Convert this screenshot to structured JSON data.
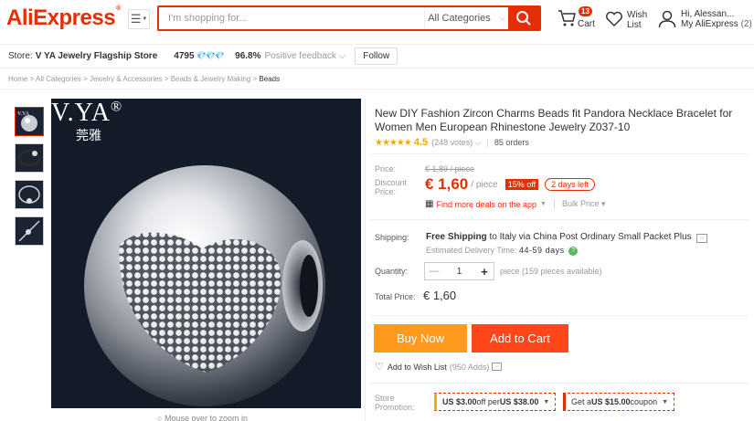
{
  "header": {
    "logo": "AliExpress",
    "logo_mark": "®",
    "search_placeholder": "I'm shopping for...",
    "search_category": "All Categories",
    "cart_count": "13",
    "cart_label": "Cart",
    "wish_label_1": "Wish",
    "wish_label_2": "List",
    "account_greeting": "Hi, Alessan...",
    "account_link": "My AliExpress",
    "account_count": "(2)"
  },
  "store": {
    "label": "Store:",
    "name": "V YA Jewelry Flagship Store",
    "score": "4795",
    "gems": "💎💎💎",
    "feedback_pct": "96.8%",
    "feedback_label": "Positive feedback",
    "follow_label": "Follow"
  },
  "breadcrumb": [
    "Home",
    "All Categories",
    "Jewelry & Accessories",
    "Beads & Jewelry Making",
    "Beads"
  ],
  "gallery": {
    "brand": "V.YA",
    "brand_mark": "®",
    "brand_cn": "莞雅",
    "zoom_hint": "Mouse over to zoom in"
  },
  "product": {
    "title": "New DIY Fashion Zircon Charms Beads fit Pandora Necklace Bracelet for Women Men European Rhinestone Jewelry Z037-10",
    "stars": "★★★★★",
    "rating": "4.5",
    "votes": "(248 votes)",
    "orders": "85 orders",
    "price_label": "Price:",
    "old_price": "€ 1,89 / piece",
    "discount_label_1": "Discount",
    "discount_label_2": "Price:",
    "price": "€ 1,60",
    "price_unit": "/ piece",
    "discount_badge": "15% off",
    "days_left": "2 days left",
    "app_deals": "Find more deals on the app",
    "bulk_price": "Bulk Price",
    "shipping_label": "Shipping:",
    "shipping_bold": "Free Shipping",
    "shipping_rest": " to Italy via China Post Ordinary Small Packet Plus",
    "delivery_label": "Estimated Delivery Time:",
    "delivery_days": "44-59 days",
    "quantity_label": "Quantity:",
    "quantity": "1",
    "quantity_note": "piece (159 pieces available)",
    "total_label": "Total Price:",
    "total": "€ 1,60",
    "buy_now": "Buy Now",
    "add_to_cart": "Add to Cart",
    "wish_label": "Add to Wish List",
    "wish_count": "(950 Adds)",
    "promo_label_1": "Store",
    "promo_label_2": "Promotion:",
    "promo1_pre": "US $3.00",
    "promo1_mid": " off per ",
    "promo1_post": "US $38.00",
    "promo2_pre": "Get a ",
    "promo2_bold": "US $15.00",
    "promo2_post": " coupon"
  },
  "colors": {
    "brand_red": "#e62e04",
    "buy_orange": "#ff9a1f",
    "cart_red": "#ff4719",
    "star_yellow": "#f2a900"
  }
}
